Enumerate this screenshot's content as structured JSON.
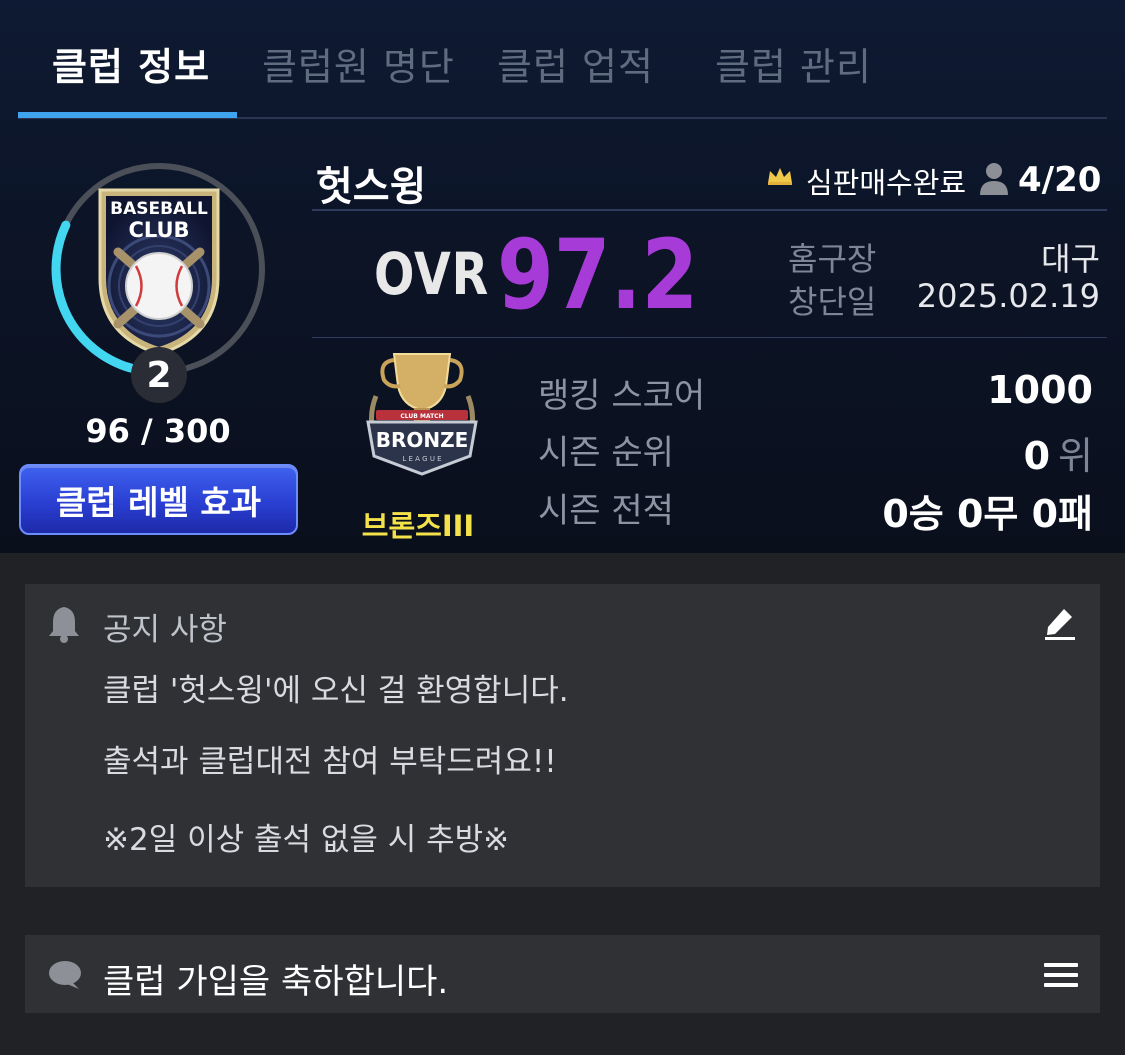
{
  "tabs": [
    {
      "label": "클럽 정보",
      "active": true
    },
    {
      "label": "클럽원 명단",
      "active": false
    },
    {
      "label": "클럽 업적",
      "active": false
    },
    {
      "label": "클럽 관리",
      "active": false
    }
  ],
  "emblem": {
    "text_line1": "BASEBALL",
    "text_line2": "CLUB",
    "level": "2",
    "exp_text": "96 / 300",
    "exp_progress": 0.32
  },
  "level_effect_button": "클럽 레벨 효과",
  "club": {
    "name": "헛스윙",
    "leader": "심판매수완료",
    "member_count": "4/20",
    "ovr_label": "OVR",
    "ovr_value": "97.2",
    "home_label": "홈구장",
    "home_value": "대구",
    "founded_label": "창단일",
    "founded_value": "2025.02.19"
  },
  "tier": {
    "badge_top_text": "CLUB MATCH",
    "badge_main_text": "BRONZE",
    "badge_sub_text": "L E A G U E",
    "name": "브론즈III"
  },
  "stats": {
    "ranking_score_label": "랭킹 스코어",
    "ranking_score_value": "1000",
    "season_rank_label": "시즌 순위",
    "season_rank_value": "0",
    "season_rank_unit": "위",
    "season_record_label": "시즌 전적",
    "season_record_value": "0승 0무 0패"
  },
  "notice": {
    "title": "공지 사항",
    "lines": [
      "클럽 '헛스윙'에 오신 걸 환영합니다.",
      "출석과 클럽대전 참여 부탁드려요!!",
      "※2일 이상 출석 없을 시 추방※"
    ]
  },
  "message": {
    "text": "클럽 가입을 축하합니다."
  },
  "colors": {
    "accent_tab": "#3fa3ee",
    "ovr": "#a73bd8",
    "tier_name": "#f4e24a",
    "button": "#2a3fd3"
  }
}
